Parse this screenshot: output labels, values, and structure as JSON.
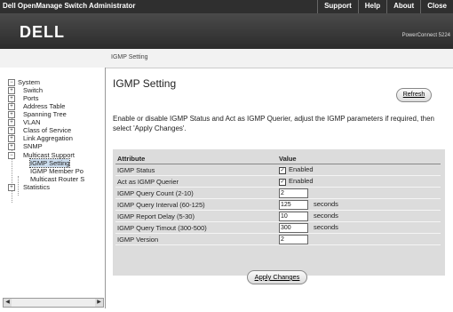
{
  "app": {
    "title": "Dell OpenManage Switch Administrator"
  },
  "top_links": [
    "Support",
    "Help",
    "About",
    "Close"
  ],
  "banner": {
    "logo": "DELL",
    "model": "PowerConnect 5224"
  },
  "breadcrumb": "IGMP Setting",
  "nav": {
    "items": [
      {
        "label": "System",
        "toggle": "−"
      },
      {
        "label": "Switch",
        "toggle": "+"
      },
      {
        "label": "Ports",
        "toggle": "+"
      },
      {
        "label": "Address Table",
        "toggle": "+"
      },
      {
        "label": "Spanning Tree",
        "toggle": "+"
      },
      {
        "label": "VLAN",
        "toggle": "+"
      },
      {
        "label": "Class of Service",
        "toggle": "+"
      },
      {
        "label": "Link Aggregation",
        "toggle": "+"
      },
      {
        "label": "SNMP",
        "toggle": "+"
      },
      {
        "label": "Multicast Support",
        "toggle": "−"
      },
      {
        "label": "IGMP Setting",
        "toggle": ""
      },
      {
        "label": "IGMP Member Po",
        "toggle": ""
      },
      {
        "label": "Multicast Router S",
        "toggle": ""
      },
      {
        "label": "Statistics",
        "toggle": "+"
      }
    ],
    "scroll_left": "◀",
    "scroll_right": "▶"
  },
  "main": {
    "title": "IGMP Setting",
    "refresh_label": "Refresh",
    "description": "Enable or disable IGMP Status and Act as IGMP Querier, adjust the IGMP parameters if required, then select 'Apply Changes'.",
    "table": {
      "headers": [
        "Attribute",
        "Value"
      ],
      "rows": [
        {
          "attribute": "IGMP Status",
          "kind": "checkbox",
          "checked": true,
          "value": "Enabled"
        },
        {
          "attribute": "Act as IGMP Querier",
          "kind": "checkbox",
          "checked": true,
          "value": "Enabled"
        },
        {
          "attribute": "IGMP Query Count (2-10)",
          "kind": "input",
          "value": "2",
          "unit": ""
        },
        {
          "attribute": "IGMP Query Interval (60-125)",
          "kind": "input",
          "value": "125",
          "unit": "seconds"
        },
        {
          "attribute": "IGMP Report Delay (5-30)",
          "kind": "input",
          "value": "10",
          "unit": "seconds"
        },
        {
          "attribute": "IGMP Query Timout (300-500)",
          "kind": "input",
          "value": "300",
          "unit": "seconds"
        },
        {
          "attribute": "IGMP Version",
          "kind": "input",
          "value": "2",
          "unit": ""
        }
      ]
    },
    "apply_label": "Apply Changes"
  },
  "colors": {
    "topbar": "#2f2f2f",
    "banner": "#3a3a3a",
    "panel": "#dcdcdc"
  }
}
